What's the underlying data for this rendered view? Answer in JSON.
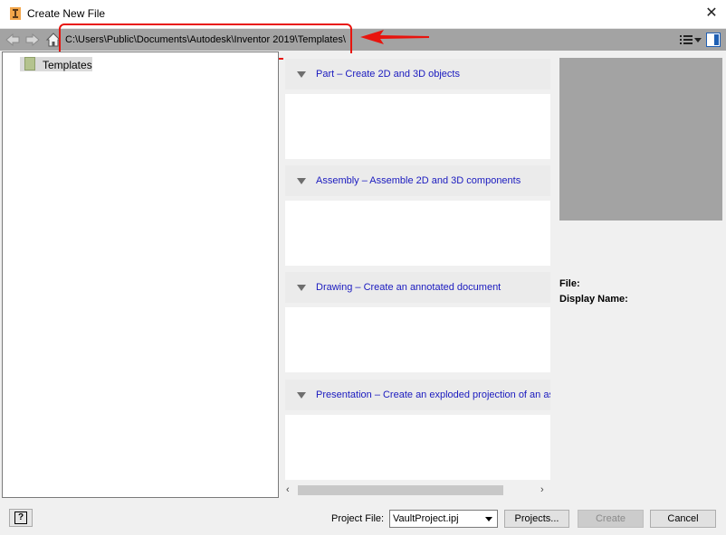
{
  "window": {
    "title": "Create New File",
    "close": "✕"
  },
  "toolbar": {
    "path": "C:\\Users\\Public\\Documents\\Autodesk\\Inventor 2019\\Templates\\"
  },
  "tree": {
    "items": [
      {
        "label": "Templates"
      }
    ]
  },
  "sections": [
    {
      "title": "Part – Create 2D and 3D objects"
    },
    {
      "title": "Assembly – Assemble 2D and 3D components"
    },
    {
      "title": "Drawing – Create an annotated document"
    },
    {
      "title": "Presentation – Create an exploded projection of an assembly"
    }
  ],
  "scrollbar": {
    "left": "‹",
    "right": "›"
  },
  "info": {
    "file_label": "File:",
    "display_name_label": "Display Name:"
  },
  "footer": {
    "help": "?",
    "project_file_label": "Project File:",
    "project_file_value": "VaultProject.ipj",
    "projects_button": "Projects...",
    "create_button": "Create",
    "cancel_button": "Cancel"
  },
  "colors": {
    "annotation": "#e8140e",
    "link": "#1a1abf",
    "toolbar": "#a3a3a3"
  }
}
